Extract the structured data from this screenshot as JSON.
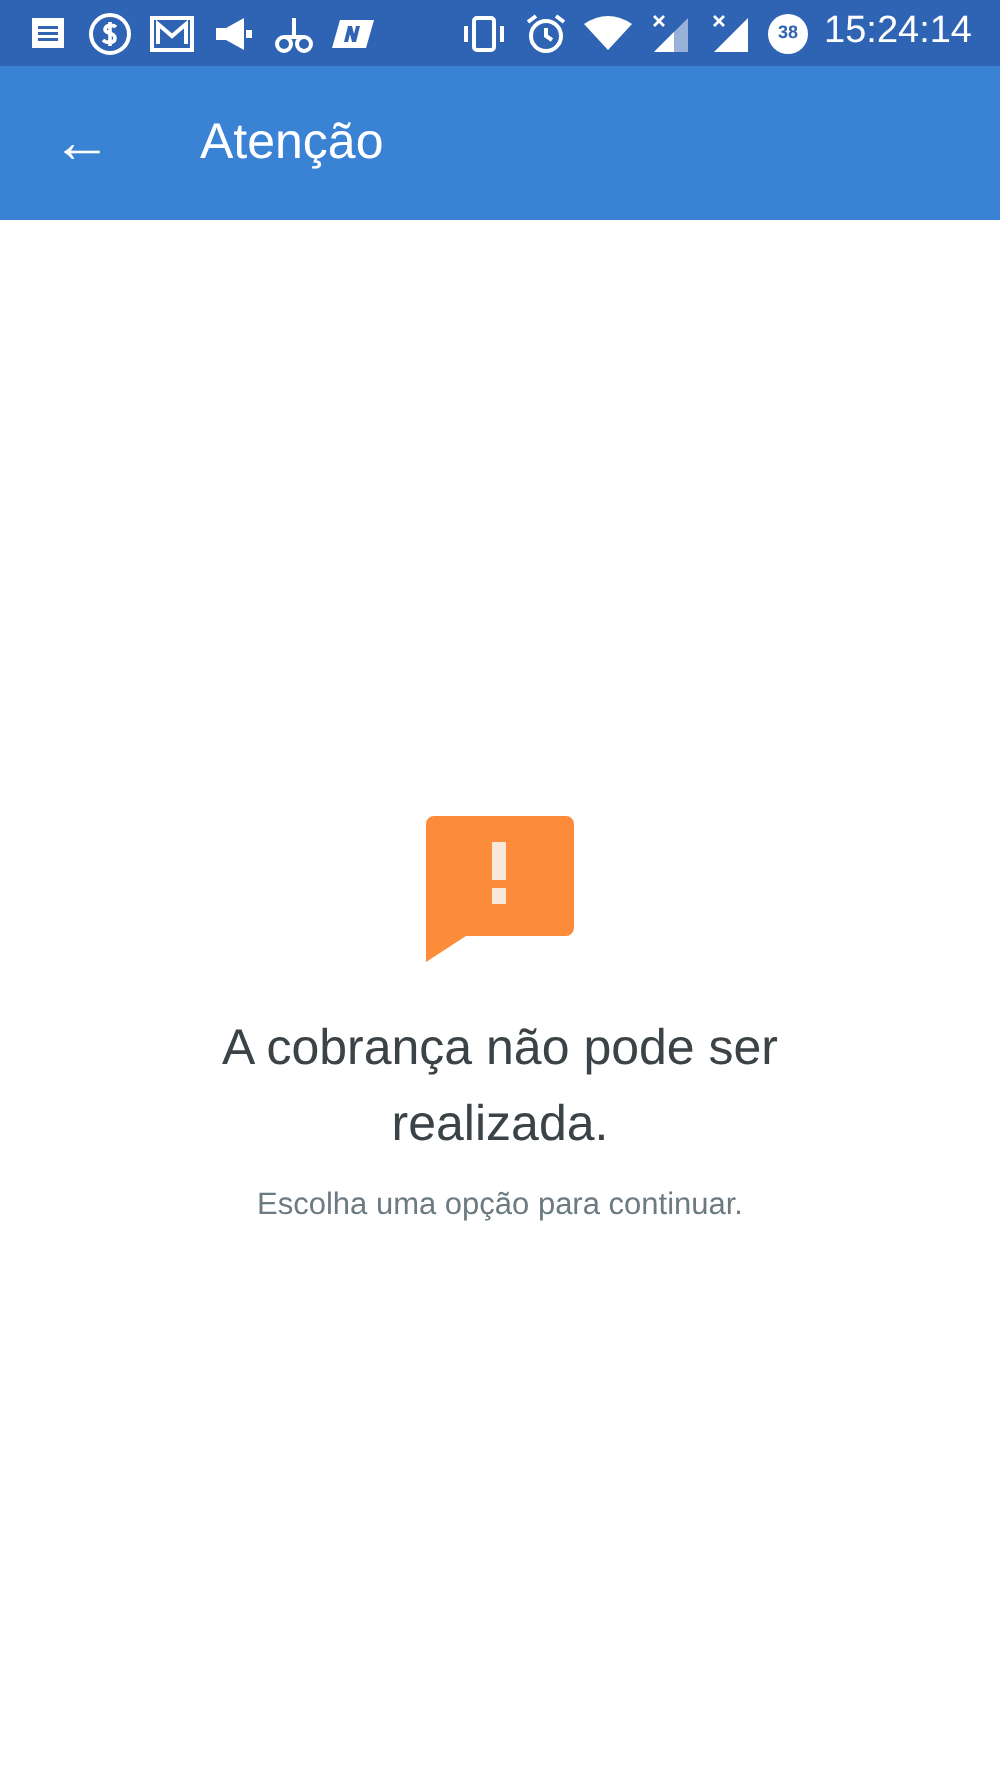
{
  "status_bar": {
    "battery": "38",
    "time": "15:24:14"
  },
  "app_bar": {
    "back": "←",
    "title": "Atenção"
  },
  "message": {
    "title": "A cobrança não pode ser realizada.",
    "subtitle": "Escolha uma opção para continuar."
  }
}
